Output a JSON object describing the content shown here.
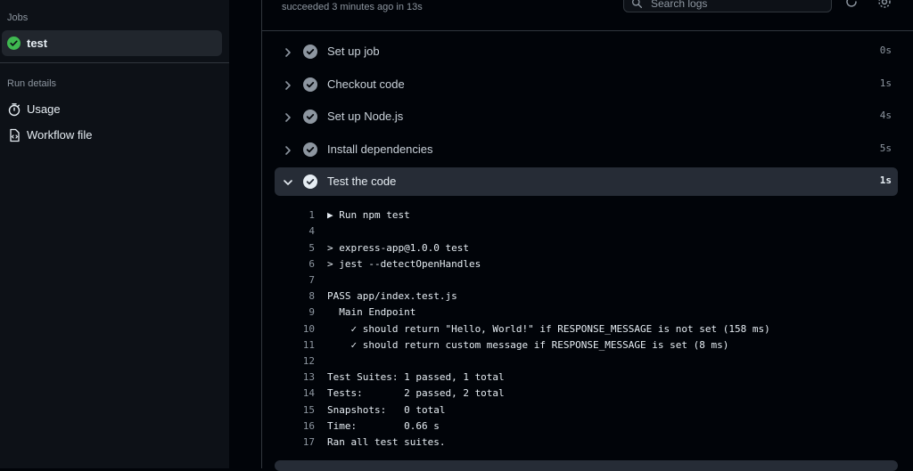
{
  "sidebar": {
    "jobs_heading": "Jobs",
    "job": {
      "name": "test",
      "status": "success"
    },
    "run_details_heading": "Run details",
    "items": [
      {
        "label": "Usage",
        "icon": "stopwatch-icon"
      },
      {
        "label": "Workflow file",
        "icon": "file-code-icon"
      }
    ]
  },
  "header": {
    "status_text": "succeeded 3 minutes ago in 13s",
    "search_placeholder": "Search logs"
  },
  "steps": [
    {
      "name": "Set up job",
      "duration": "0s",
      "expanded": false
    },
    {
      "name": "Checkout code",
      "duration": "1s",
      "expanded": false
    },
    {
      "name": "Set up Node.js",
      "duration": "4s",
      "expanded": false
    },
    {
      "name": "Install dependencies",
      "duration": "5s",
      "expanded": false
    },
    {
      "name": "Test the code",
      "duration": "1s",
      "expanded": true
    }
  ],
  "log_lines": [
    {
      "n": "1",
      "text": "▶ Run npm test"
    },
    {
      "n": "4",
      "text": ""
    },
    {
      "n": "5",
      "text": "> express-app@1.0.0 test"
    },
    {
      "n": "6",
      "text": "> jest --detectOpenHandles"
    },
    {
      "n": "7",
      "text": ""
    },
    {
      "n": "8",
      "text": "PASS app/index.test.js"
    },
    {
      "n": "9",
      "text": "  Main Endpoint"
    },
    {
      "n": "10",
      "text": "    ✓ should return \"Hello, World!\" if RESPONSE_MESSAGE is not set (158 ms)"
    },
    {
      "n": "11",
      "text": "    ✓ should return custom message if RESPONSE_MESSAGE is set (8 ms)"
    },
    {
      "n": "12",
      "text": ""
    },
    {
      "n": "13",
      "text": "Test Suites: 1 passed, 1 total"
    },
    {
      "n": "14",
      "text": "Tests:       2 passed, 2 total"
    },
    {
      "n": "15",
      "text": "Snapshots:   0 total"
    },
    {
      "n": "16",
      "text": "Time:        0.66 s"
    },
    {
      "n": "17",
      "text": "Ran all test suites."
    }
  ],
  "colors": {
    "success": "#3fb950",
    "background": "#010409",
    "sidebar": "#0d1117",
    "expanded_step": "#262c36"
  }
}
